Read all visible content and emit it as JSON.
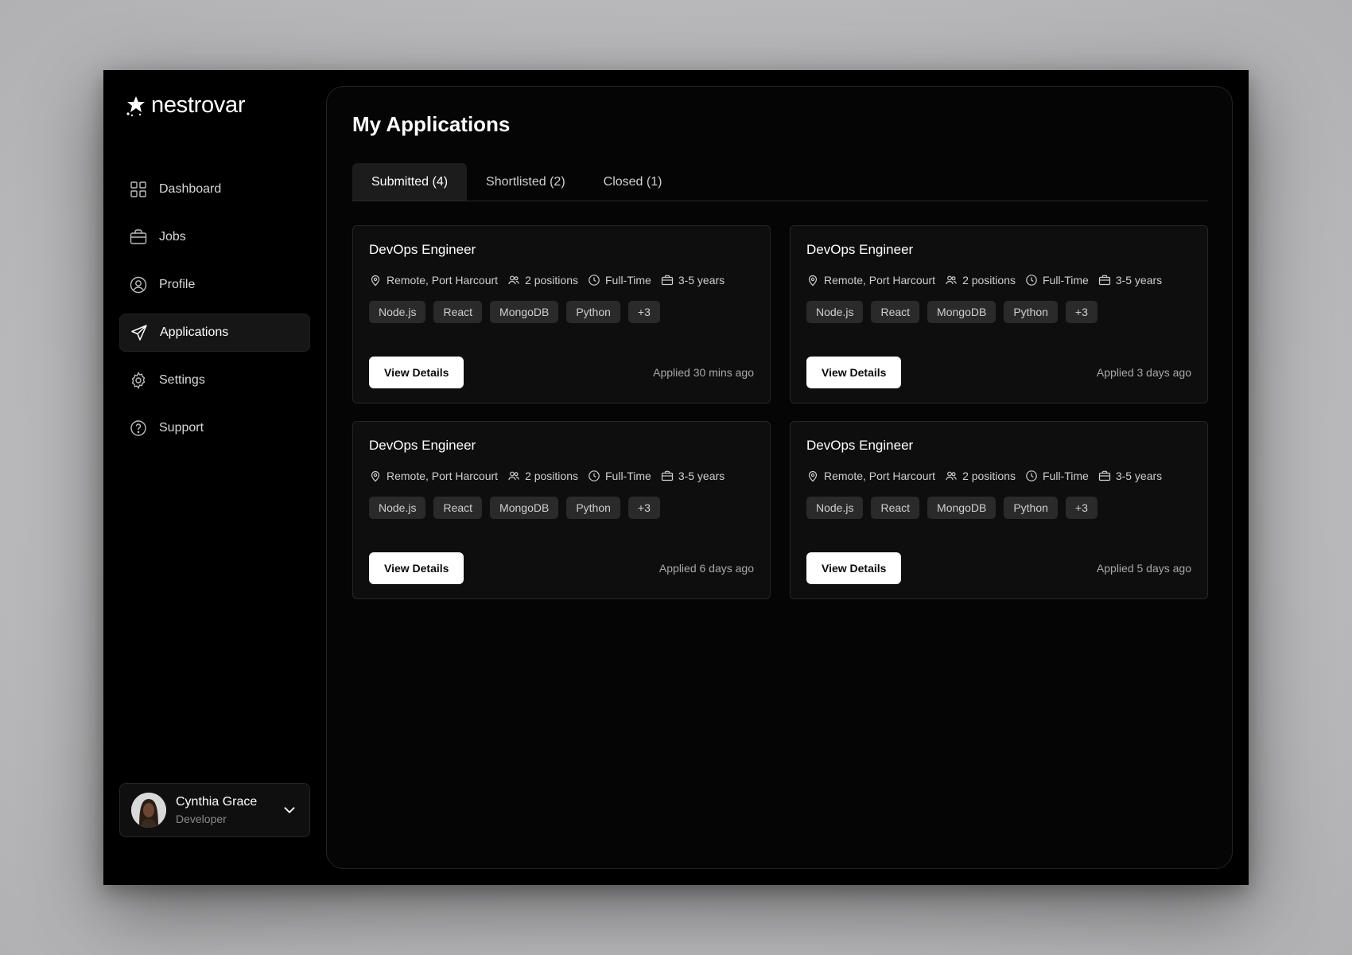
{
  "brand": {
    "name": "nestrovar"
  },
  "sidebar": {
    "items": [
      {
        "label": "Dashboard",
        "icon": "grid-icon",
        "active": false
      },
      {
        "label": "Jobs",
        "icon": "briefcase-icon",
        "active": false
      },
      {
        "label": "Profile",
        "icon": "user-circle-icon",
        "active": false
      },
      {
        "label": "Applications",
        "icon": "send-icon",
        "active": true
      },
      {
        "label": "Settings",
        "icon": "gear-icon",
        "active": false
      },
      {
        "label": "Support",
        "icon": "help-circle-icon",
        "active": false
      }
    ]
  },
  "user": {
    "name": "Cynthia Grace",
    "role": "Developer"
  },
  "main": {
    "title": "My Applications",
    "tabs": [
      {
        "label": "Submitted (4)",
        "active": true
      },
      {
        "label": "Shortlisted (2)",
        "active": false
      },
      {
        "label": "Closed (1)",
        "active": false
      }
    ],
    "cards": [
      {
        "title": "DevOps Engineer",
        "location": "Remote, Port Harcourt",
        "positions": "2 positions",
        "type": "Full-Time",
        "experience": "3-5 years",
        "tags": [
          "Node.js",
          "React",
          "MongoDB",
          "Python",
          "+3"
        ],
        "button": "View Details",
        "applied": "Applied 30 mins ago"
      },
      {
        "title": "DevOps Engineer",
        "location": "Remote, Port Harcourt",
        "positions": "2 positions",
        "type": "Full-Time",
        "experience": "3-5 years",
        "tags": [
          "Node.js",
          "React",
          "MongoDB",
          "Python",
          "+3"
        ],
        "button": "View Details",
        "applied": "Applied 3 days ago"
      },
      {
        "title": "DevOps Engineer",
        "location": "Remote, Port Harcourt",
        "positions": "2 positions",
        "type": "Full-Time",
        "experience": "3-5 years",
        "tags": [
          "Node.js",
          "React",
          "MongoDB",
          "Python",
          "+3"
        ],
        "button": "View Details",
        "applied": "Applied 6 days ago"
      },
      {
        "title": "DevOps Engineer",
        "location": "Remote, Port Harcourt",
        "positions": "2 positions",
        "type": "Full-Time",
        "experience": "3-5 years",
        "tags": [
          "Node.js",
          "React",
          "MongoDB",
          "Python",
          "+3"
        ],
        "button": "View Details",
        "applied": "Applied 5 days ago"
      }
    ]
  },
  "colors": {
    "background": "#000000",
    "panel": "#050505",
    "card": "#0e0e0e",
    "tag": "#2a2a2a",
    "button": "#ffffff"
  }
}
